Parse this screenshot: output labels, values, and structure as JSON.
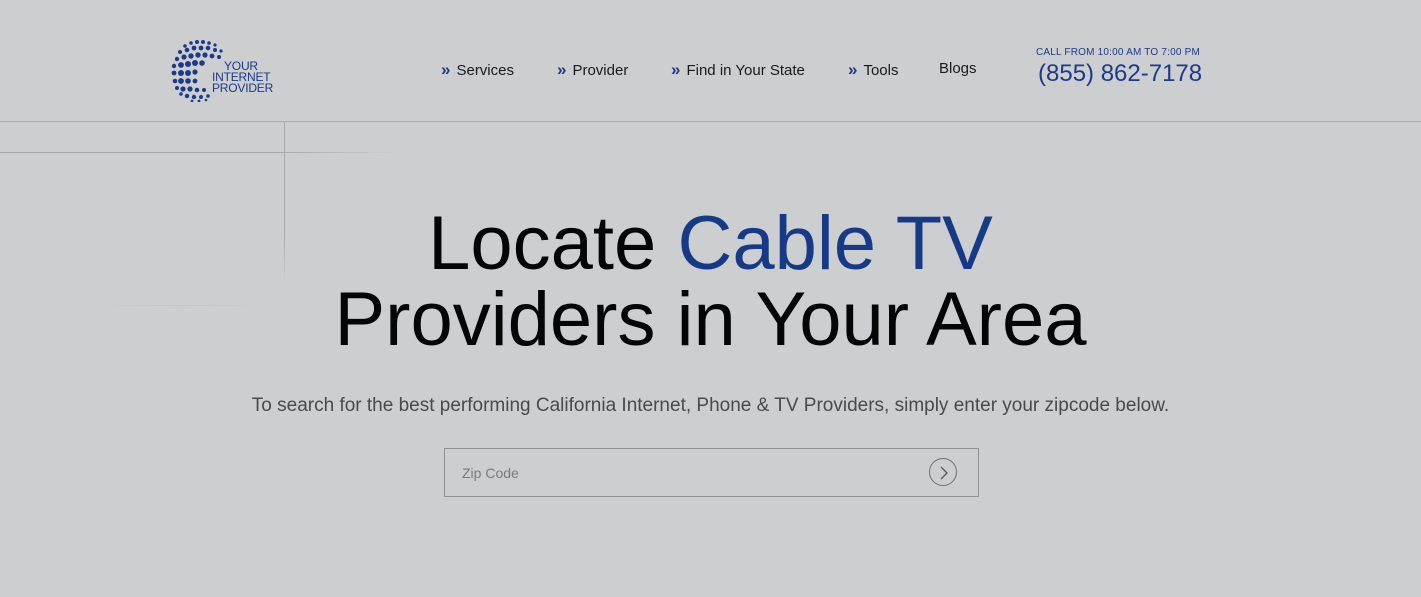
{
  "brand": {
    "logo_lines": [
      "YOUR",
      "INTERNET",
      "PROVIDER"
    ],
    "logo_icon": "globe-dots-icon",
    "color": "#1b3a8a"
  },
  "nav": {
    "items": [
      {
        "label": "Services",
        "has_chevron": true
      },
      {
        "label": "Provider",
        "has_chevron": true
      },
      {
        "label": "Find in Your State",
        "has_chevron": true
      },
      {
        "label": "Tools",
        "has_chevron": true
      },
      {
        "label": "Blogs",
        "has_chevron": false
      }
    ],
    "chevron_glyph": "»"
  },
  "contact": {
    "call_hours": "CALL FROM 10:00 AM TO 7:00 PM",
    "phone": "(855) 862-7178"
  },
  "hero": {
    "title_pre": "Locate ",
    "title_accent": "Cable TV",
    "title_line2": "Providers in Your Area",
    "subtitle": "To search for the best performing California Internet, Phone & TV Providers, simply enter your zipcode below.",
    "accent_color": "#173a86"
  },
  "search": {
    "placeholder": "Zip Code",
    "value": "",
    "submit_icon": "chevron-right-circle-icon"
  },
  "colors": {
    "background": "#cdced0",
    "brand_blue": "#1b3a8a"
  }
}
